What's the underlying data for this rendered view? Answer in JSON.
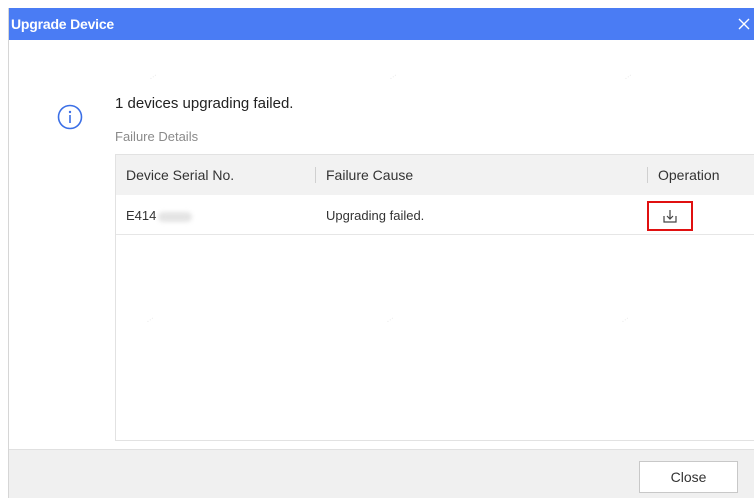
{
  "dialog": {
    "title": "Upgrade Device",
    "message": "1 devices upgrading failed.",
    "failure_label": "Failure Details"
  },
  "table": {
    "columns": [
      "Device Serial No.",
      "Failure Cause",
      "Operation"
    ],
    "rows": [
      {
        "serial": "E414",
        "cause": "Upgrading failed."
      }
    ]
  },
  "footer": {
    "close_label": "Close"
  },
  "icons": {
    "close": "close-icon",
    "info": "info-circle-icon",
    "download": "download-icon"
  },
  "colors": {
    "titlebar": "#4a7cf4",
    "highlight": "#e01010",
    "info_icon": "#3b6fe6"
  }
}
